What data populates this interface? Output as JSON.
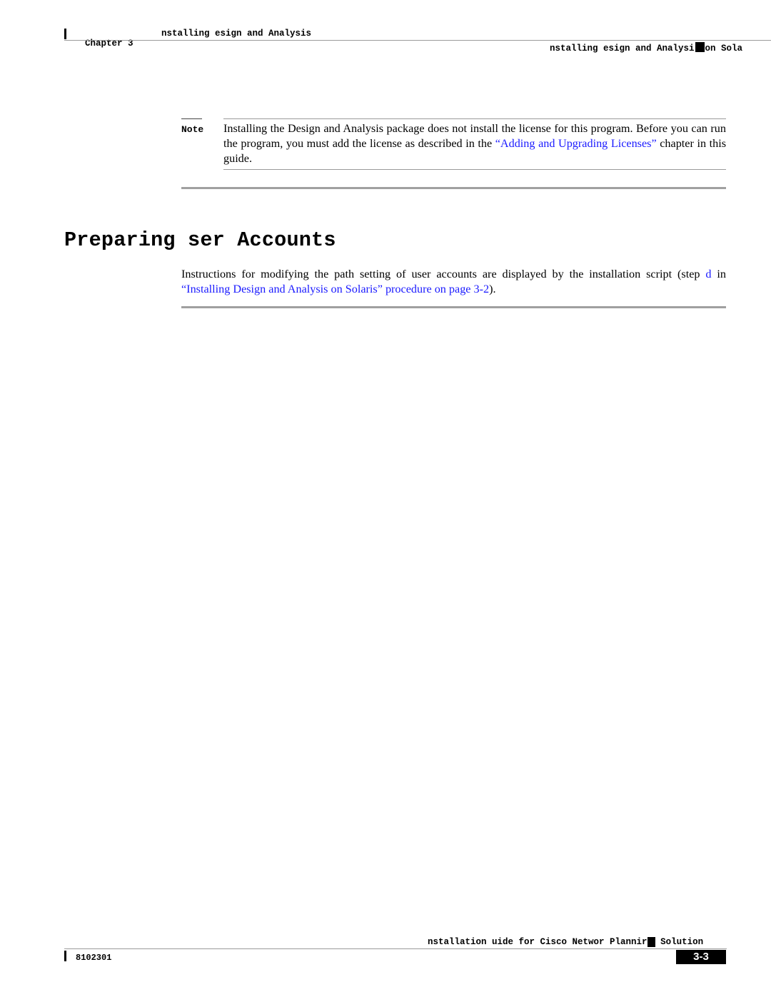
{
  "header": {
    "chapter_label": "Chapter 3",
    "chapter_title": "nstalling esign and Analysis",
    "section_title_left": "nstalling esign and Analysi",
    "section_title_right": "on Sola"
  },
  "note": {
    "label": "Note",
    "text_before_link": "Installing the Design and Analysis package does not install the license for this program. Before you can run the program, you must add the license as described in the ",
    "link_text": "“Adding and Upgrading Licenses”",
    "text_after_link": " chapter in this guide."
  },
  "section": {
    "title": "Preparing ser Accounts",
    "body_before": "Instructions for modifying the path setting of user accounts are displayed by the installation script (step ",
    "step_link": "d",
    "body_middle": " in ",
    "procedure_link": "“Installing Design and Analysis on Solaris” procedure on page 3-2",
    "body_after": ")."
  },
  "footer": {
    "guide_title_left": "nstallation uide for Cisco Networ Plannir",
    "guide_title_right": "Solution",
    "doc_number": "8102301",
    "page_number": "3-3"
  },
  "colors": {
    "link": "#1a1aff",
    "rule": "#9a9a9a",
    "text": "#000000"
  }
}
